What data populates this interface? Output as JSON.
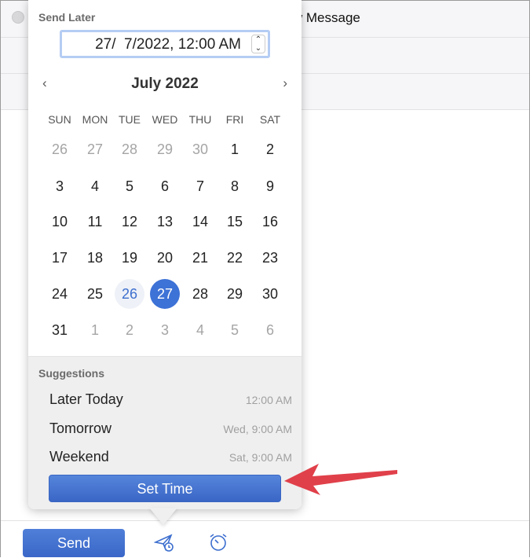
{
  "window": {
    "title": "New Message"
  },
  "popover": {
    "title": "Send Later",
    "datetime_value": "27/  7/2022, 12:00 AM",
    "month_label": "July 2022",
    "prev_glyph": "‹",
    "next_glyph": "›",
    "weekdays": [
      "SUN",
      "MON",
      "TUE",
      "WED",
      "THU",
      "FRI",
      "SAT"
    ],
    "weeks": [
      [
        "26",
        "27",
        "28",
        "29",
        "30",
        "1",
        "2"
      ],
      [
        "3",
        "4",
        "5",
        "6",
        "7",
        "8",
        "9"
      ],
      [
        "10",
        "11",
        "12",
        "13",
        "14",
        "15",
        "16"
      ],
      [
        "17",
        "18",
        "19",
        "20",
        "21",
        "22",
        "23"
      ],
      [
        "24",
        "25",
        "26",
        "27",
        "28",
        "29",
        "30"
      ],
      [
        "31",
        "1",
        "2",
        "3",
        "4",
        "5",
        "6"
      ]
    ],
    "today": "26",
    "selected": "27",
    "suggestions_title": "Suggestions",
    "suggestions": [
      {
        "label": "Later Today",
        "time": "12:00 AM"
      },
      {
        "label": "Tomorrow",
        "time": "Wed, 9:00 AM"
      },
      {
        "label": "Weekend",
        "time": "Sat, 9:00 AM"
      }
    ],
    "set_time_label": "Set Time"
  },
  "toolbar": {
    "send_label": "Send",
    "icons": [
      "send-later-icon",
      "alarm-clock-icon"
    ]
  },
  "colors": {
    "accent": "#3d72d6",
    "annotation_arrow": "#e0404a"
  }
}
